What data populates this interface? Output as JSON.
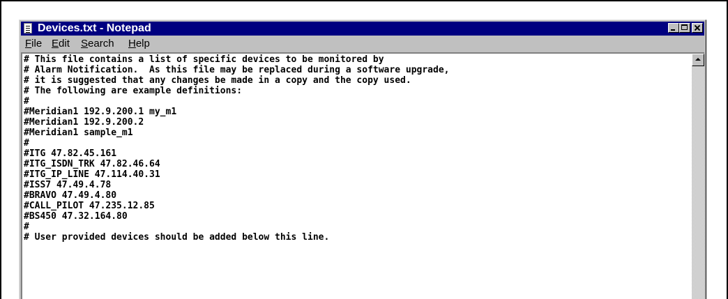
{
  "window": {
    "title": "Devices.txt - Notepad"
  },
  "menu": [
    {
      "mnemonic": "F",
      "rest": "ile"
    },
    {
      "mnemonic": "E",
      "rest": "dit"
    },
    {
      "mnemonic": "S",
      "rest": "earch"
    },
    {
      "mnemonic": "H",
      "rest": "elp"
    }
  ],
  "document": {
    "lines": [
      "# This file contains a list of specific devices to be monitored by",
      "# Alarm Notification.  As this file may be replaced during a software upgrade,",
      "# it is suggested that any changes be made in a copy and the copy used.",
      "# The following are example definitions:",
      "#",
      "#Meridian1 192.9.200.1 my_m1",
      "#Meridian1 192.9.200.2",
      "#Meridian1 sample_m1",
      "#",
      "#ITG 47.82.45.161",
      "#ITG_ISDN_TRK 47.82.46.64",
      "#ITG_IP_LINE 47.114.40.31",
      "#ISS7 47.49.4.78",
      "#BRAVO 47.49.4.80",
      "#CALL_PILOT 47.235.12.85",
      "#BS450 47.32.164.80",
      "#",
      "# User provided devices should be added below this line."
    ]
  },
  "icons": {
    "app": "notepad-icon",
    "minimize": "minimize-icon",
    "maximize": "maximize-icon",
    "close": "close-icon",
    "scroll_up": "arrow-up-icon"
  }
}
